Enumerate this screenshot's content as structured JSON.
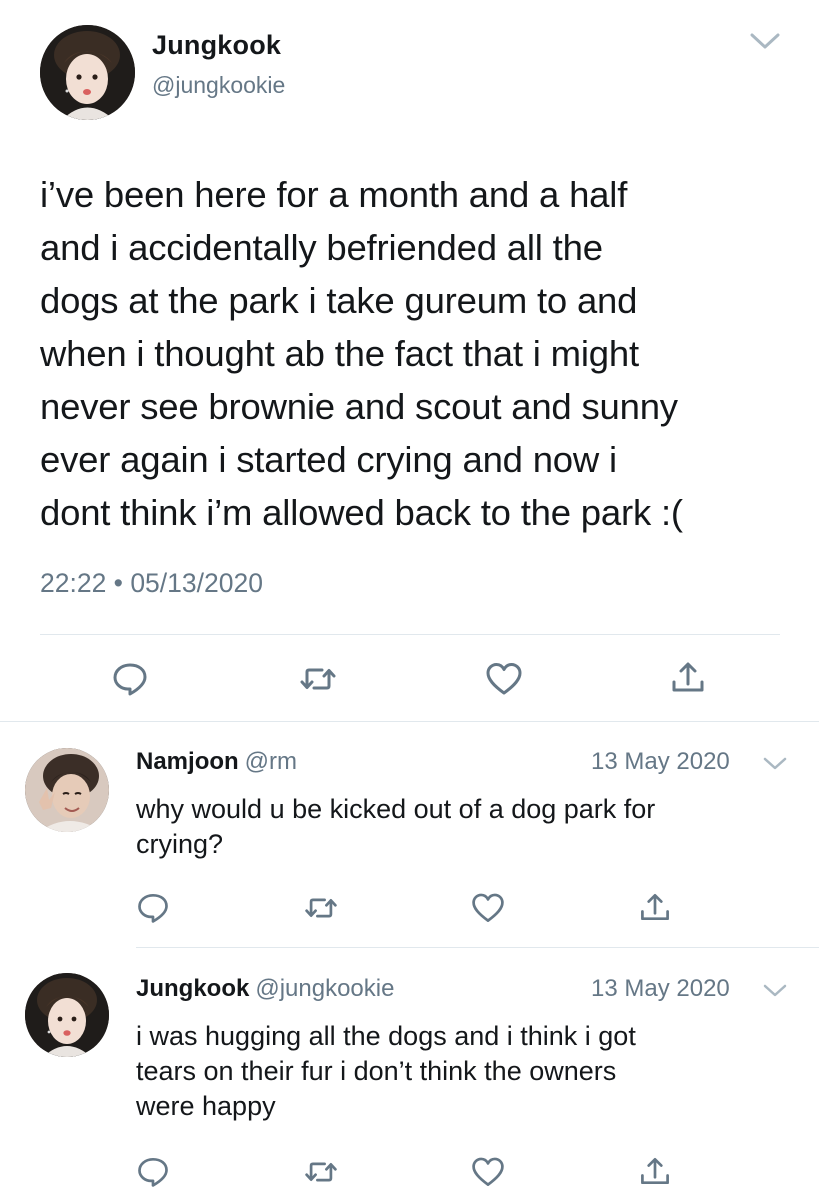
{
  "main_tweet": {
    "display_name": "Jungkook",
    "handle": "@jungkookie",
    "text_lines": [
      "i’ve been here for a month and a half",
      "and i accidentally befriended all the",
      "dogs at the park i take gureum to and",
      "when i thought ab the fact that i might",
      "never see brownie and scout and sunny",
      "ever again i started crying and now i",
      "dont think i’m allowed back to the park :("
    ],
    "timestamp": "22:22 • 05/13/2020",
    "actions": [
      "reply-icon",
      "retweet-icon",
      "like-icon",
      "share-icon"
    ]
  },
  "replies": [
    {
      "display_name": "Namjoon",
      "handle": "@rm",
      "date": "13 May 2020",
      "text_lines": [
        "why would u be kicked out of a dog park for",
        "crying?"
      ]
    },
    {
      "display_name": "Jungkook",
      "handle": "@jungkookie",
      "date": "13 May 2020",
      "text_lines": [
        "i was hugging all the dogs and i think i got",
        "tears on their fur i don’t think the owners",
        "were happy"
      ]
    }
  ],
  "colors": {
    "text": "#14171a",
    "secondary": "#657786",
    "divider": "#e1e8ed"
  }
}
